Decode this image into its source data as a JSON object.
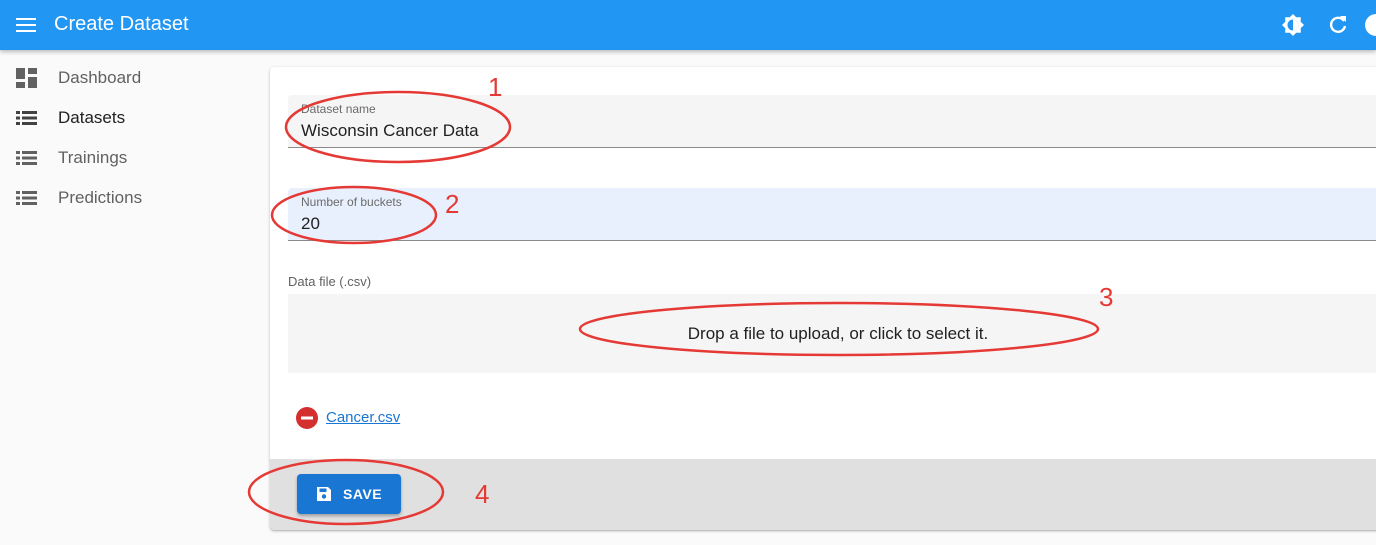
{
  "appbar": {
    "title": "Create Dataset",
    "icons": [
      "menu-icon",
      "brightness-icon",
      "refresh-icon",
      "account-icon"
    ],
    "color": "#2196f3"
  },
  "sidebar": {
    "items": [
      {
        "label": "Dashboard",
        "icon": "dashboard-icon"
      },
      {
        "label": "Datasets",
        "icon": "list-icon",
        "active": true
      },
      {
        "label": "Trainings",
        "icon": "list-icon"
      },
      {
        "label": "Predictions",
        "icon": "list-icon"
      }
    ]
  },
  "form": {
    "dataset_name": {
      "label": "Dataset name",
      "value": "Wisconsin Cancer Data"
    },
    "buckets": {
      "label": "Number of buckets",
      "value": "20"
    },
    "data_file": {
      "label": "Data file (.csv)",
      "dropzone_text": "Drop a file to upload, or click to select it.",
      "file_name": "Cancer.csv"
    }
  },
  "toolbar": {
    "save_label": "SAVE",
    "save_color": "#1976d2"
  },
  "annotations": {
    "a1": "1",
    "a2": "2",
    "a3": "3",
    "a4": "4",
    "color": "#e53935"
  }
}
